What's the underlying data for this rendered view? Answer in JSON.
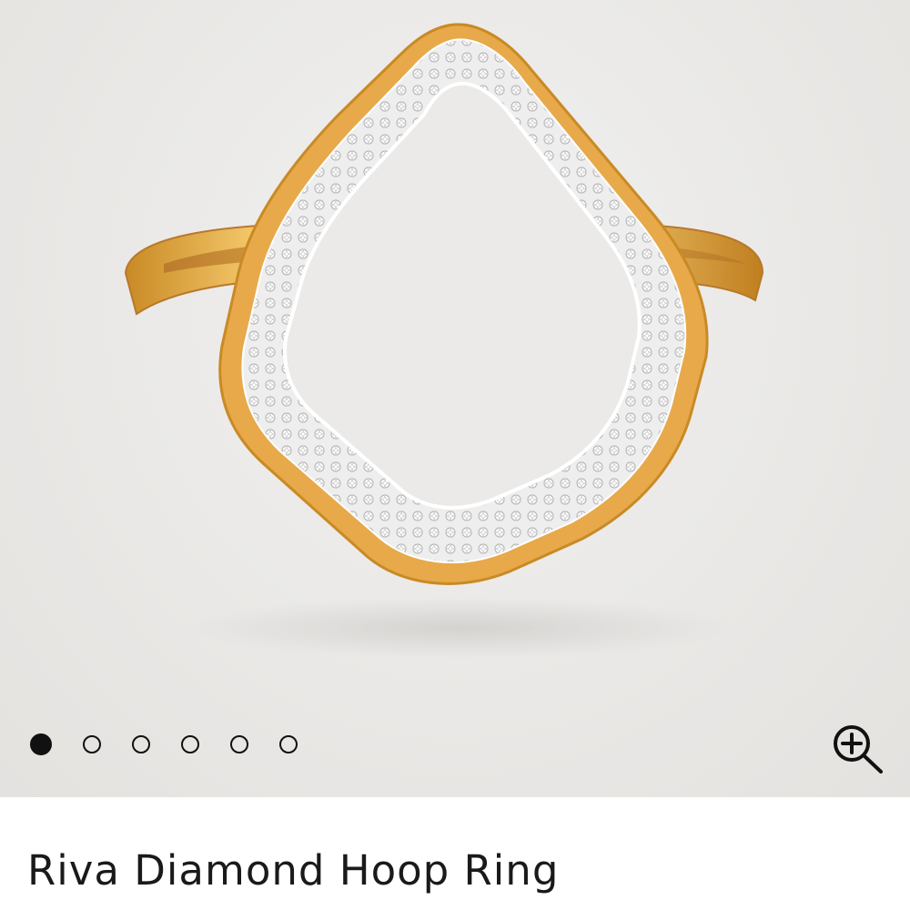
{
  "gallery": {
    "image_count": 6,
    "active_index": 0,
    "image_subject": "ring-icon",
    "zoom_icon": "zoom-in-icon",
    "colors": {
      "background": "#ebeae8",
      "gold": "#d9a441",
      "pave": "#e8e8e8",
      "dot": "#111111"
    }
  },
  "product": {
    "title": "Riva Diamond Hoop Ring"
  }
}
